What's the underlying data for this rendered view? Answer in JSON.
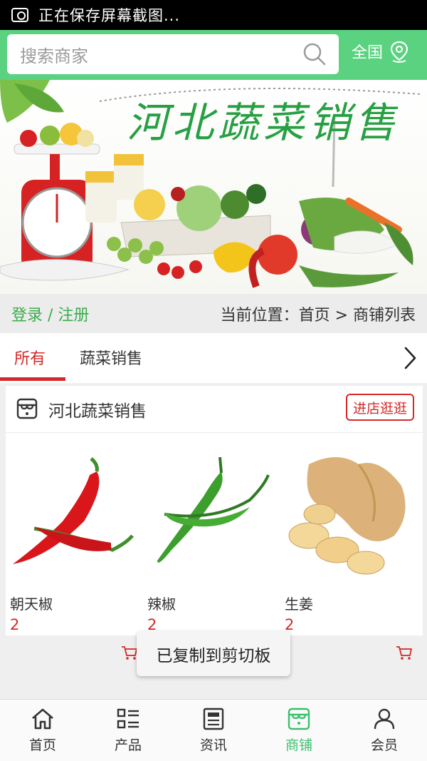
{
  "statusbar": {
    "text": "正在保存屏幕截图..."
  },
  "header": {
    "search_placeholder": "搜索商家",
    "region": "全国",
    "accent": "#5ad27f"
  },
  "banner": {
    "title": "河北蔬菜销售"
  },
  "crumbbar": {
    "login": "登录 / 注册",
    "location": "当前位置：首页 > 商铺列表"
  },
  "tabs": [
    {
      "label": "所有"
    },
    {
      "label": "蔬菜销售"
    }
  ],
  "shop": {
    "name": "河北蔬菜销售",
    "visit": "进店逛逛",
    "products": [
      {
        "name": "朝天椒",
        "price": "2"
      },
      {
        "name": "辣椒",
        "price": "2"
      },
      {
        "name": "生姜",
        "price": "2"
      }
    ]
  },
  "toast": "已复制到剪切板",
  "bottom_nav": [
    {
      "label": "首页",
      "icon": "home-icon"
    },
    {
      "label": "产品",
      "icon": "list-icon"
    },
    {
      "label": "资讯",
      "icon": "news-icon"
    },
    {
      "label": "商铺",
      "icon": "store-icon"
    },
    {
      "label": "会员",
      "icon": "user-icon"
    }
  ]
}
